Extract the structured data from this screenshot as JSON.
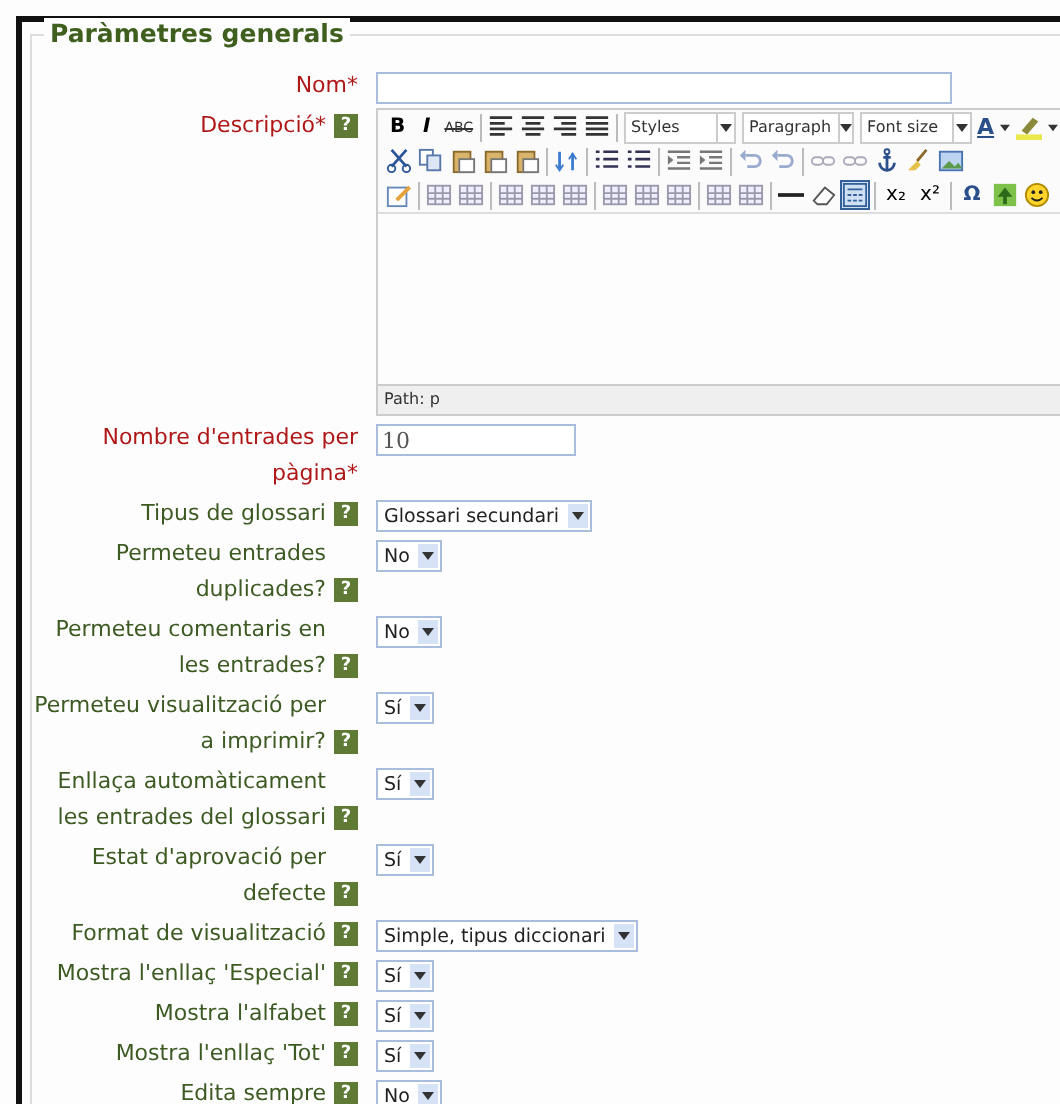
{
  "legend": "Paràmetres generals",
  "rows": [
    {
      "kind": "text",
      "label": "Nom*",
      "required": true,
      "value": ""
    },
    {
      "kind": "editor",
      "label": "Descripció*",
      "required": true,
      "help": "?"
    },
    {
      "kind": "text",
      "label": "Nombre d'entrades per pàgina*",
      "required": true,
      "value": "10"
    },
    {
      "kind": "select",
      "label": "Tipus de glossari",
      "required": false,
      "help": "?",
      "value": "Glossari secundari"
    },
    {
      "kind": "select",
      "label": "Permeteu entrades duplicades?",
      "required": false,
      "help": "?",
      "value": "No"
    },
    {
      "kind": "select",
      "label": "Permeteu comentaris en les entrades?",
      "required": false,
      "help": "?",
      "value": "No"
    },
    {
      "kind": "select",
      "label": "Permeteu visualització per a imprimir?",
      "required": false,
      "help": "?",
      "value": "Sí"
    },
    {
      "kind": "select",
      "label": "Enllaça automàticament les entrades del glossari",
      "required": false,
      "help": "?",
      "value": "Sí"
    },
    {
      "kind": "select",
      "label": "Estat d'aprovació per defecte",
      "required": false,
      "help": "?",
      "value": "Sí"
    },
    {
      "kind": "select",
      "label": "Format de visualització",
      "required": false,
      "help": "?",
      "value": "Simple, tipus diccionari"
    },
    {
      "kind": "select",
      "label": "Mostra l'enllaç 'Especial'",
      "required": false,
      "help": "?",
      "value": "Sí"
    },
    {
      "kind": "select",
      "label": "Mostra l'alfabet",
      "required": false,
      "help": "?",
      "value": "Sí"
    },
    {
      "kind": "select",
      "label": "Mostra l'enllaç 'Tot'",
      "required": false,
      "help": "?",
      "value": "Sí"
    },
    {
      "kind": "select",
      "label": "Edita sempre",
      "required": false,
      "help": "?",
      "value": "No"
    }
  ],
  "editor": {
    "bold": "B",
    "italic": "I",
    "strike": "ABC",
    "styles": "Styles",
    "paragraph": "Paragraph",
    "font_size": "Font size",
    "text_color": "A",
    "subscript": "x₂",
    "superscript": "x²",
    "special_char": "Ω",
    "path": "Path: p"
  }
}
